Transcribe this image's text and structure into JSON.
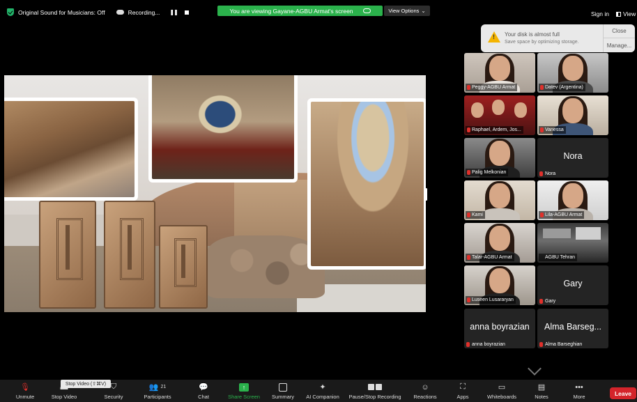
{
  "topbar": {
    "audio_status": "Original Sound for Musicians: Off",
    "recording": "Recording...",
    "viewing": "You are viewing Gayane-AGBU Armat's screen",
    "view_options": "View Options",
    "sign_in": "Sign in",
    "view": "View"
  },
  "toast": {
    "title": "Your disk is almost full",
    "subtitle": "Save space by optimizing storage.",
    "close": "Close",
    "manage": "Manage..."
  },
  "participants": [
    {
      "name": "Peggy-AGBU Armat",
      "video": true
    },
    {
      "name": "Datev (Argentina)",
      "video": true
    },
    {
      "name": "Raphael, Ardem, Jos...",
      "video": true
    },
    {
      "name": "Vanessa",
      "video": true
    },
    {
      "name": "Palig Melkonian",
      "video": true
    },
    {
      "name": "Nora",
      "display": "Nora",
      "video": false
    },
    {
      "name": "Kami",
      "video": true
    },
    {
      "name": "Lila-AGBU Armat",
      "video": true
    },
    {
      "name": "Talar-AGBU Armat",
      "video": true
    },
    {
      "name": "AGBU Tehran",
      "video": true
    },
    {
      "name": "Luseen Lusararyan",
      "video": true
    },
    {
      "name": "Gary",
      "display": "Gary",
      "video": false
    },
    {
      "name": "anna boyrazian",
      "display": "anna boyrazian",
      "video": false
    },
    {
      "name": "Alma Barseghian",
      "display": "Alma Barseg...",
      "video": false
    }
  ],
  "toolbar": {
    "unmute": "Unmute",
    "stop_video": "Stop Video",
    "security": "Security",
    "participants": "Participants",
    "participants_count": "21",
    "chat": "Chat",
    "share_screen": "Share Screen",
    "summary": "Summary",
    "ai_companion": "AI Companion",
    "pause_stop_recording": "Pause/Stop Recording",
    "reactions": "Reactions",
    "apps": "Apps",
    "whiteboards": "Whiteboards",
    "notes": "Notes",
    "more": "More",
    "leave": "Leave",
    "tooltip": "Stop Video (⇧⌘V)"
  },
  "colors": {
    "green": "#2bb24c",
    "leave_red": "#d4242b",
    "toolbar_bg": "#1a1a1a",
    "tile_bg": "#242424"
  }
}
